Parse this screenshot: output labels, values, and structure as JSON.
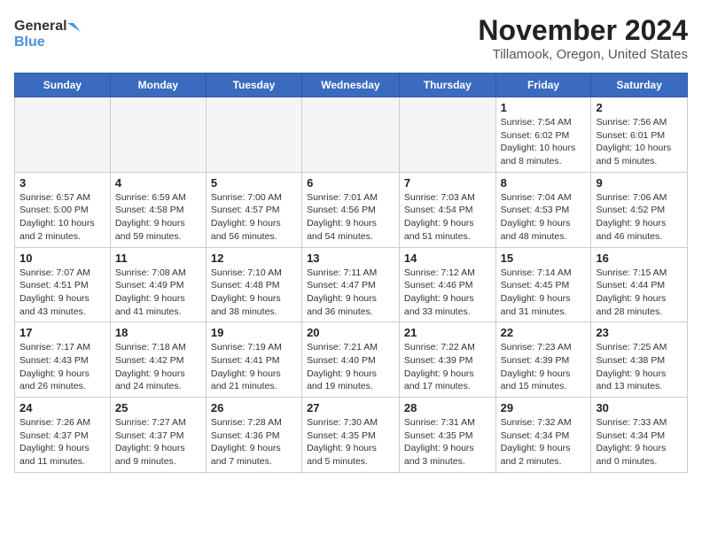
{
  "header": {
    "logo_line1": "General",
    "logo_line2": "Blue",
    "month": "November 2024",
    "location": "Tillamook, Oregon, United States"
  },
  "weekdays": [
    "Sunday",
    "Monday",
    "Tuesday",
    "Wednesday",
    "Thursday",
    "Friday",
    "Saturday"
  ],
  "weeks": [
    [
      {
        "day": "",
        "detail": ""
      },
      {
        "day": "",
        "detail": ""
      },
      {
        "day": "",
        "detail": ""
      },
      {
        "day": "",
        "detail": ""
      },
      {
        "day": "",
        "detail": ""
      },
      {
        "day": "1",
        "detail": "Sunrise: 7:54 AM\nSunset: 6:02 PM\nDaylight: 10 hours\nand 8 minutes."
      },
      {
        "day": "2",
        "detail": "Sunrise: 7:56 AM\nSunset: 6:01 PM\nDaylight: 10 hours\nand 5 minutes."
      }
    ],
    [
      {
        "day": "3",
        "detail": "Sunrise: 6:57 AM\nSunset: 5:00 PM\nDaylight: 10 hours\nand 2 minutes."
      },
      {
        "day": "4",
        "detail": "Sunrise: 6:59 AM\nSunset: 4:58 PM\nDaylight: 9 hours\nand 59 minutes."
      },
      {
        "day": "5",
        "detail": "Sunrise: 7:00 AM\nSunset: 4:57 PM\nDaylight: 9 hours\nand 56 minutes."
      },
      {
        "day": "6",
        "detail": "Sunrise: 7:01 AM\nSunset: 4:56 PM\nDaylight: 9 hours\nand 54 minutes."
      },
      {
        "day": "7",
        "detail": "Sunrise: 7:03 AM\nSunset: 4:54 PM\nDaylight: 9 hours\nand 51 minutes."
      },
      {
        "day": "8",
        "detail": "Sunrise: 7:04 AM\nSunset: 4:53 PM\nDaylight: 9 hours\nand 48 minutes."
      },
      {
        "day": "9",
        "detail": "Sunrise: 7:06 AM\nSunset: 4:52 PM\nDaylight: 9 hours\nand 46 minutes."
      }
    ],
    [
      {
        "day": "10",
        "detail": "Sunrise: 7:07 AM\nSunset: 4:51 PM\nDaylight: 9 hours\nand 43 minutes."
      },
      {
        "day": "11",
        "detail": "Sunrise: 7:08 AM\nSunset: 4:49 PM\nDaylight: 9 hours\nand 41 minutes."
      },
      {
        "day": "12",
        "detail": "Sunrise: 7:10 AM\nSunset: 4:48 PM\nDaylight: 9 hours\nand 38 minutes."
      },
      {
        "day": "13",
        "detail": "Sunrise: 7:11 AM\nSunset: 4:47 PM\nDaylight: 9 hours\nand 36 minutes."
      },
      {
        "day": "14",
        "detail": "Sunrise: 7:12 AM\nSunset: 4:46 PM\nDaylight: 9 hours\nand 33 minutes."
      },
      {
        "day": "15",
        "detail": "Sunrise: 7:14 AM\nSunset: 4:45 PM\nDaylight: 9 hours\nand 31 minutes."
      },
      {
        "day": "16",
        "detail": "Sunrise: 7:15 AM\nSunset: 4:44 PM\nDaylight: 9 hours\nand 28 minutes."
      }
    ],
    [
      {
        "day": "17",
        "detail": "Sunrise: 7:17 AM\nSunset: 4:43 PM\nDaylight: 9 hours\nand 26 minutes."
      },
      {
        "day": "18",
        "detail": "Sunrise: 7:18 AM\nSunset: 4:42 PM\nDaylight: 9 hours\nand 24 minutes."
      },
      {
        "day": "19",
        "detail": "Sunrise: 7:19 AM\nSunset: 4:41 PM\nDaylight: 9 hours\nand 21 minutes."
      },
      {
        "day": "20",
        "detail": "Sunrise: 7:21 AM\nSunset: 4:40 PM\nDaylight: 9 hours\nand 19 minutes."
      },
      {
        "day": "21",
        "detail": "Sunrise: 7:22 AM\nSunset: 4:39 PM\nDaylight: 9 hours\nand 17 minutes."
      },
      {
        "day": "22",
        "detail": "Sunrise: 7:23 AM\nSunset: 4:39 PM\nDaylight: 9 hours\nand 15 minutes."
      },
      {
        "day": "23",
        "detail": "Sunrise: 7:25 AM\nSunset: 4:38 PM\nDaylight: 9 hours\nand 13 minutes."
      }
    ],
    [
      {
        "day": "24",
        "detail": "Sunrise: 7:26 AM\nSunset: 4:37 PM\nDaylight: 9 hours\nand 11 minutes."
      },
      {
        "day": "25",
        "detail": "Sunrise: 7:27 AM\nSunset: 4:37 PM\nDaylight: 9 hours\nand 9 minutes."
      },
      {
        "day": "26",
        "detail": "Sunrise: 7:28 AM\nSunset: 4:36 PM\nDaylight: 9 hours\nand 7 minutes."
      },
      {
        "day": "27",
        "detail": "Sunrise: 7:30 AM\nSunset: 4:35 PM\nDaylight: 9 hours\nand 5 minutes."
      },
      {
        "day": "28",
        "detail": "Sunrise: 7:31 AM\nSunset: 4:35 PM\nDaylight: 9 hours\nand 3 minutes."
      },
      {
        "day": "29",
        "detail": "Sunrise: 7:32 AM\nSunset: 4:34 PM\nDaylight: 9 hours\nand 2 minutes."
      },
      {
        "day": "30",
        "detail": "Sunrise: 7:33 AM\nSunset: 4:34 PM\nDaylight: 9 hours\nand 0 minutes."
      }
    ]
  ]
}
